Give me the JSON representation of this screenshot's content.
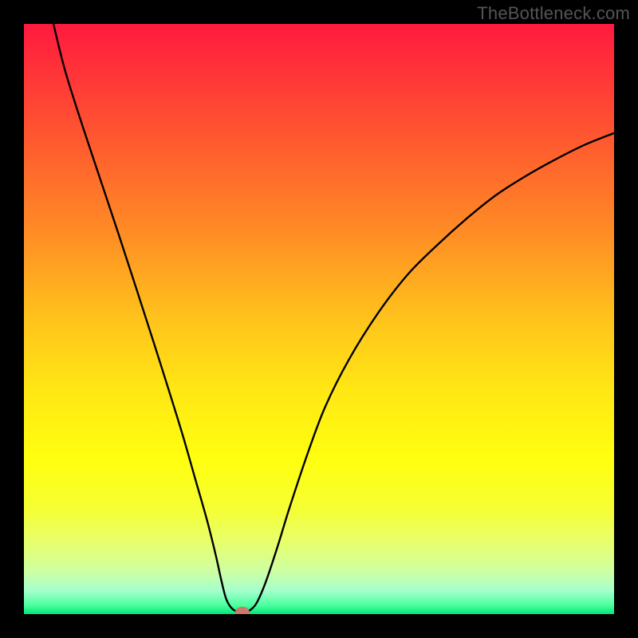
{
  "watermark": "TheBottleneck.com",
  "chart_data": {
    "type": "line",
    "title": "",
    "xlabel": "",
    "ylabel": "",
    "xlim": [
      0,
      100
    ],
    "ylim": [
      0,
      100
    ],
    "grid": false,
    "background_gradient": {
      "stops": [
        {
          "offset": 0.0,
          "color": "#ff1a3f"
        },
        {
          "offset": 0.06,
          "color": "#ff2d3a"
        },
        {
          "offset": 0.2,
          "color": "#ff5a2f"
        },
        {
          "offset": 0.35,
          "color": "#ff8b25"
        },
        {
          "offset": 0.5,
          "color": "#ffc31c"
        },
        {
          "offset": 0.62,
          "color": "#ffe714"
        },
        {
          "offset": 0.74,
          "color": "#ffff10"
        },
        {
          "offset": 0.82,
          "color": "#f6ff32"
        },
        {
          "offset": 0.88,
          "color": "#e7ff6e"
        },
        {
          "offset": 0.93,
          "color": "#ccffa6"
        },
        {
          "offset": 0.96,
          "color": "#a6ffcd"
        },
        {
          "offset": 0.985,
          "color": "#4dff9e"
        },
        {
          "offset": 1.0,
          "color": "#00e67a"
        }
      ]
    },
    "series": [
      {
        "name": "curve",
        "stroke": "#000000",
        "stroke_width": 2.4,
        "points": [
          {
            "x": 5.0,
            "y": 100.0
          },
          {
            "x": 7.0,
            "y": 92.0
          },
          {
            "x": 10.0,
            "y": 82.5
          },
          {
            "x": 13.0,
            "y": 73.5
          },
          {
            "x": 16.0,
            "y": 64.5
          },
          {
            "x": 19.0,
            "y": 55.3
          },
          {
            "x": 22.0,
            "y": 46.0
          },
          {
            "x": 25.0,
            "y": 36.5
          },
          {
            "x": 27.0,
            "y": 30.0
          },
          {
            "x": 29.0,
            "y": 23.0
          },
          {
            "x": 31.0,
            "y": 16.0
          },
          {
            "x": 32.5,
            "y": 10.0
          },
          {
            "x": 33.5,
            "y": 5.5
          },
          {
            "x": 34.3,
            "y": 2.5
          },
          {
            "x": 35.3,
            "y": 0.9
          },
          {
            "x": 36.5,
            "y": 0.3
          },
          {
            "x": 37.5,
            "y": 0.3
          },
          {
            "x": 38.5,
            "y": 0.8
          },
          {
            "x": 39.5,
            "y": 2.0
          },
          {
            "x": 41.0,
            "y": 5.5
          },
          {
            "x": 43.0,
            "y": 11.5
          },
          {
            "x": 45.0,
            "y": 18.0
          },
          {
            "x": 48.0,
            "y": 27.0
          },
          {
            "x": 51.0,
            "y": 35.0
          },
          {
            "x": 55.0,
            "y": 43.0
          },
          {
            "x": 60.0,
            "y": 51.0
          },
          {
            "x": 65.0,
            "y": 57.5
          },
          {
            "x": 70.0,
            "y": 62.5
          },
          {
            "x": 75.0,
            "y": 67.0
          },
          {
            "x": 80.0,
            "y": 71.0
          },
          {
            "x": 85.0,
            "y": 74.2
          },
          {
            "x": 90.0,
            "y": 77.0
          },
          {
            "x": 95.0,
            "y": 79.5
          },
          {
            "x": 100.0,
            "y": 81.5
          }
        ]
      }
    ],
    "marker": {
      "x": 37.0,
      "y": 0.35,
      "rx": 1.2,
      "ry": 0.9,
      "fill": "#c97a6a"
    }
  }
}
